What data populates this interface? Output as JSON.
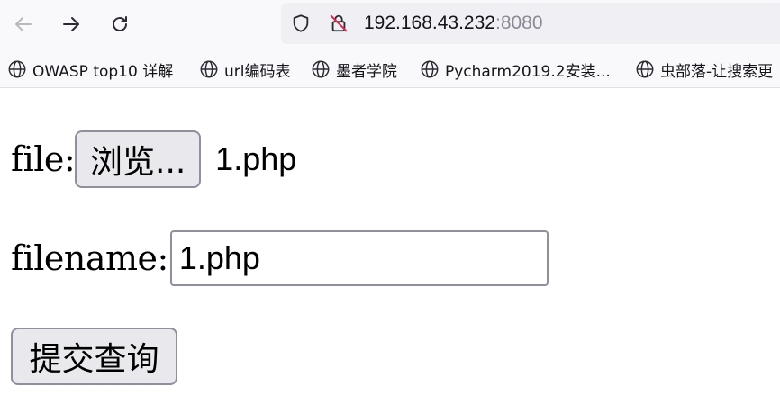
{
  "browser": {
    "url_host": "192.168.43.232",
    "url_port": ":8080",
    "icons": [
      "back-arrow-icon",
      "forward-arrow-icon",
      "reload-icon",
      "shield-icon",
      "insecure-lock-icon",
      "globe-icon"
    ],
    "bookmarks": [
      "OWASP top10 详解",
      "url编码表",
      "墨者学院",
      "Pycharm2019.2安装...",
      "虫部落-让搜索更"
    ]
  },
  "form": {
    "file_label": "file:",
    "browse_button": "浏览...",
    "selected_file": "1.php",
    "filename_label": "filename:",
    "filename_value": "1.php",
    "submit_button": "提交查询"
  }
}
